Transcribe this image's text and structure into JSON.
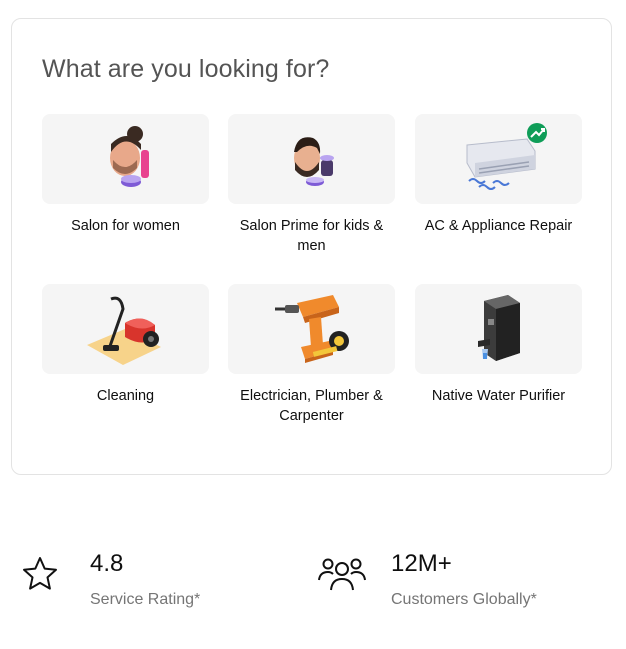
{
  "section": {
    "title": "What are you looking for?"
  },
  "categories": [
    {
      "label": "Salon for women",
      "icon": "salon-women-icon"
    },
    {
      "label": "Salon Prime for kids & men",
      "icon": "salon-men-icon"
    },
    {
      "label": "AC & Appliance Repair",
      "icon": "ac-repair-icon"
    },
    {
      "label": "Cleaning",
      "icon": "vacuum-cleaner-icon"
    },
    {
      "label": "Electrician, Plumber & Carpenter",
      "icon": "drill-icon"
    },
    {
      "label": "Native Water Purifier",
      "icon": "water-purifier-icon"
    }
  ],
  "stats": [
    {
      "value": "4.8",
      "label": "Service Rating*",
      "icon": "star-icon"
    },
    {
      "value": "12M+",
      "label": "Customers Globally*",
      "icon": "users-icon"
    }
  ],
  "colors": {
    "tile_bg": "#f5f5f5",
    "border": "#e3e3e3",
    "muted_text": "#757575",
    "accent_green": "#0f9d58"
  }
}
